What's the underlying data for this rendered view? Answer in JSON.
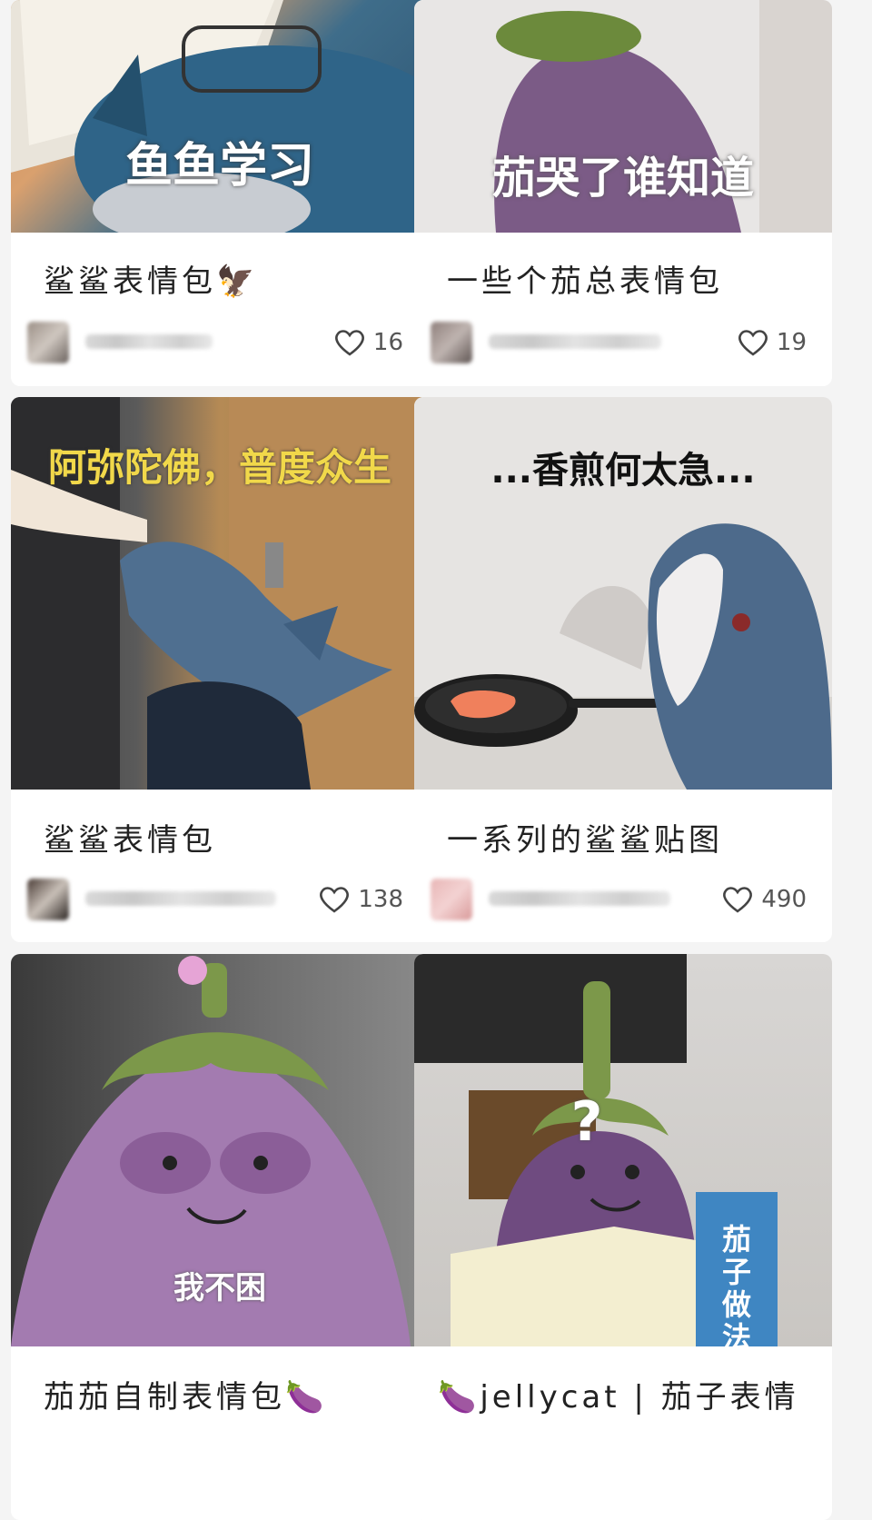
{
  "cards": [
    {
      "image_caption": "鱼鱼学习",
      "title": "鲨鲨表情包🦅",
      "likes": "16"
    },
    {
      "image_caption": "茄哭了谁知道",
      "title": "一些个茄总表情包",
      "likes": "19"
    },
    {
      "image_caption": "阿弥陀佛，普度众生",
      "title": "鲨鲨表情包",
      "likes": "138"
    },
    {
      "image_caption": "...香煎何太急...",
      "title": "一系列的鲨鲨贴图",
      "likes": "490"
    },
    {
      "image_caption": "我不困",
      "title": "茄茄自制表情包🍆",
      "likes": ""
    },
    {
      "image_caption": "?",
      "book_title": "茄子做法",
      "title": "🍆jellycat | 茄子表情",
      "likes": ""
    }
  ],
  "icons": {
    "like": "heart-icon",
    "avatar": "user-avatar"
  },
  "colors": {
    "background": "#f4f4f4",
    "card": "#ffffff",
    "text": "#222222",
    "like_count": "#555555"
  }
}
